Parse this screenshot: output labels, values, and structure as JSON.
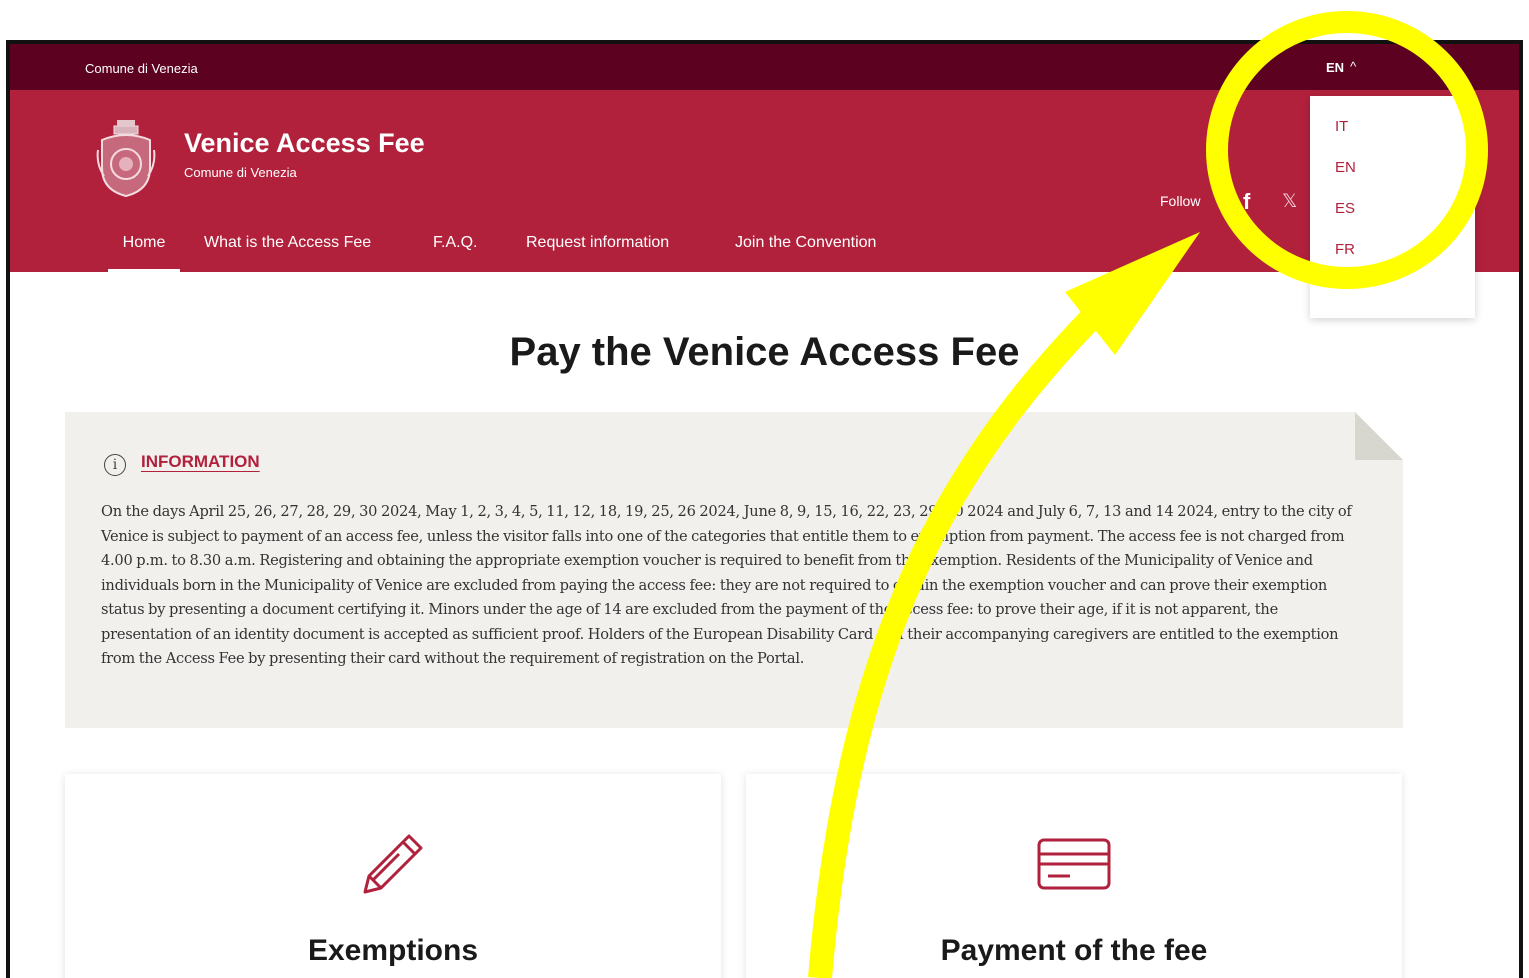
{
  "topbar": {
    "org": "Comune di Venezia",
    "current_lang": "EN",
    "chevron": "^"
  },
  "header": {
    "title": "Venice Access Fee",
    "subtitle": "Comune di Venezia",
    "follow_label": "Follow",
    "social": {
      "facebook": "f",
      "x": "𝕏"
    }
  },
  "nav": [
    {
      "label": "Home"
    },
    {
      "label": "What is the Access Fee"
    },
    {
      "label": "F.A.Q."
    },
    {
      "label": "Request information"
    },
    {
      "label": "Join the Convention"
    }
  ],
  "lang_menu": [
    "IT",
    "EN",
    "ES",
    "FR"
  ],
  "main": {
    "title": "Pay the Venice Access Fee",
    "info": {
      "icon": "i",
      "heading": "INFORMATION",
      "text": "On the days April 25, 26, 27, 28, 29, 30 2024, May 1, 2, 3, 4, 5, 11, 12, 18, 19, 25, 26 2024, June 8, 9, 15, 16, 22, 23, 29, 30 2024 and July 6, 7, 13 and 14 2024, entry to the city of Venice is subject to payment of an access fee, unless the visitor falls into one of the categories that entitle them to exemption from payment. The access fee is not charged from 4.00 p.m. to 8.30 a.m. Registering and obtaining the appropriate exemption voucher is required to benefit from the exemption. Residents of the Municipality of Venice and individuals born in the Municipality of Venice are excluded from paying the access fee: they are not required to obtain the exemption voucher and can prove their exemption status by presenting a document certifying it. Minors under the age of 14 are excluded from the payment of the access fee: to prove their age, if it is not apparent, the presentation of an identity document is accepted as sufficient proof. Holders of the European Disability Card and their accompanying caregivers are entitled to the exemption from the Access Fee by presenting their card without the requirement of registration on the Portal."
    },
    "cards": [
      {
        "title": "Exemptions",
        "icon": "pencil-icon"
      },
      {
        "title": "Payment of the fee",
        "icon": "credit-card-icon"
      }
    ]
  },
  "colors": {
    "topbar": "#5c0120",
    "header": "#b1213c",
    "accent": "#b1213c",
    "annotation": "#ffff00"
  }
}
